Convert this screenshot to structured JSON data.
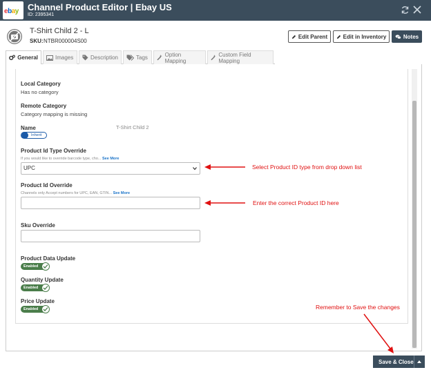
{
  "header": {
    "logo_text": "ebay",
    "title": "Channel Product Editor | Ebay US",
    "id_text": "ID: 2395341"
  },
  "product": {
    "name": "T-Shirt Child 2 - L",
    "sku_label": "SKU:",
    "sku_value": "NTBR000004S00"
  },
  "buttons": {
    "edit_parent": "Edit Parent",
    "edit_inventory": "Edit in Inventory",
    "notes": "Notes",
    "save_close": "Save & Close"
  },
  "tabs": [
    {
      "label": "General",
      "icon": "gears-icon",
      "active": true
    },
    {
      "label": "Images",
      "icon": "image-icon",
      "active": false
    },
    {
      "label": "Description",
      "icon": "tag-icon",
      "active": false
    },
    {
      "label": "Tags",
      "icon": "tags-icon",
      "active": false
    },
    {
      "label": "Option Mapping",
      "icon": "wand-icon",
      "active": false
    },
    {
      "label": "Custom Field Mapping",
      "icon": "wand-icon",
      "active": false
    }
  ],
  "form": {
    "local_category_label": "Local Category",
    "local_category_value": "Has no category",
    "remote_category_label": "Remote Category",
    "remote_category_value": "Category mapping is missing",
    "name_label": "Name",
    "name_toggle": "Inherit",
    "name_value": "T-Shirt Child 2",
    "pid_type_label": "Product Id Type Override",
    "pid_type_hint": "If you would like to override barcode type, cho...",
    "see_more": "See More",
    "pid_type_value": "UPC",
    "pid_label": "Product Id Override",
    "pid_hint": "Channels only Accept numbers for UPC, EAN, GTIN...",
    "pid_value": "",
    "sku_label": "Sku Override",
    "sku_value": "",
    "product_data_label": "Product Data Update",
    "quantity_label": "Quantity Update",
    "price_label": "Price Update",
    "enabled_text": "Enabled"
  },
  "annotations": {
    "a1": "Select Product ID type from drop down list",
    "a2": "Enter the correct Product ID here",
    "a3": "Remember to Save the changes"
  },
  "colors": {
    "header_bg": "#3b4d5c",
    "annotation": "#e01010",
    "toggle_on": "#4a7d4a",
    "link": "#1a73c8"
  }
}
